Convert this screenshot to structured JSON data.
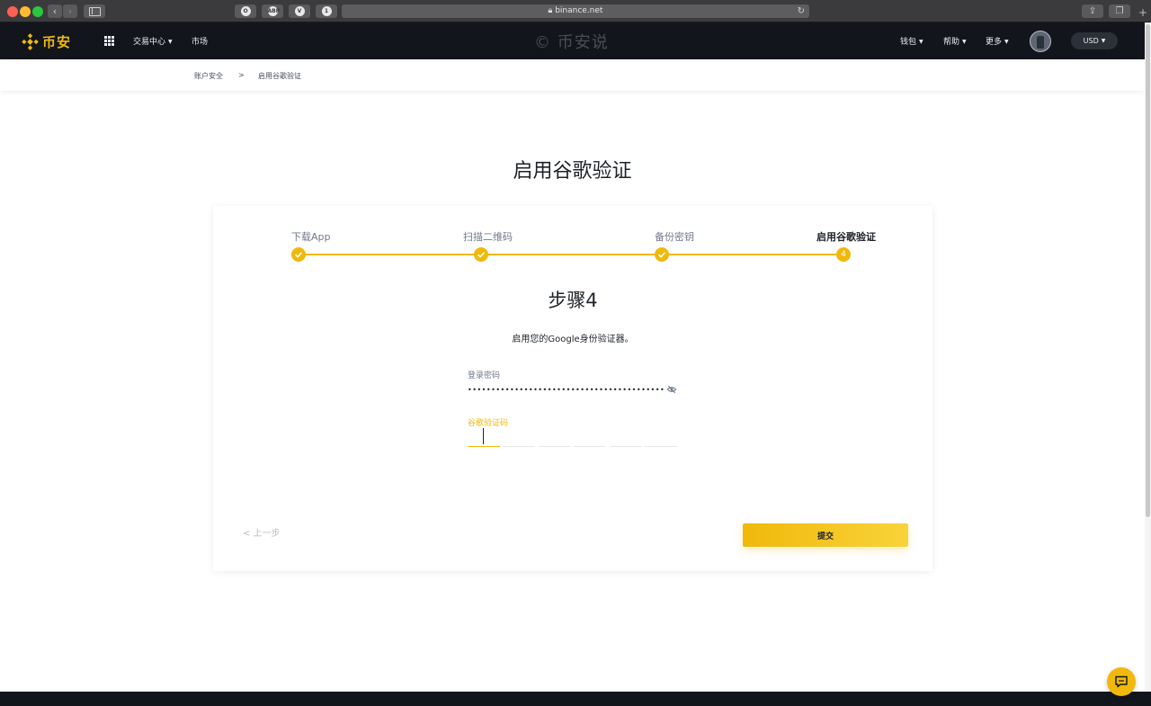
{
  "browser": {
    "url": "binance.net",
    "extensions": [
      "OPERA",
      "ABP",
      "VB",
      "1P"
    ]
  },
  "header": {
    "brand": "币安",
    "nav": {
      "trade": "交易中心",
      "markets": "市场",
      "wallet": "钱包",
      "help": "帮助",
      "more": "更多"
    },
    "watermark": "© 币安说",
    "currency": "USD"
  },
  "breadcrumb": {
    "parent": "账户安全",
    "separator": ">",
    "current": "启用谷歌验证"
  },
  "page": {
    "title": "启用谷歌验证"
  },
  "steps": [
    {
      "label": "下载App",
      "status": "done"
    },
    {
      "label": "扫描二维码",
      "status": "done"
    },
    {
      "label": "备份密钥",
      "status": "done"
    },
    {
      "label": "启用谷歌验证",
      "status": "current",
      "number": "4"
    }
  ],
  "form": {
    "step_title": "步骤4",
    "description": "启用您的Google身份验证器。",
    "password_label": "登录密码",
    "password_value": "••••••••••••••••••••••••••••••••••••••••••••••…",
    "code_label": "谷歌验证码",
    "code_digits": [
      "",
      "",
      "",
      "",
      "",
      ""
    ],
    "prev_label": "< 上一步",
    "submit_label": "提交"
  },
  "colors": {
    "accent": "#f0b90b",
    "header_bg": "#12161c"
  }
}
